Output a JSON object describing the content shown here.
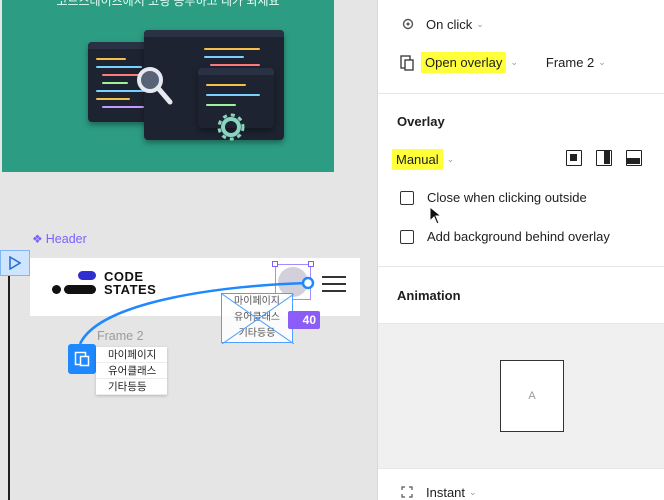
{
  "canvas": {
    "hero_text": "코드스테이츠에서 코딩 공부하고 네가 되세요",
    "header_component": "Header",
    "logo": {
      "line1": "CODE",
      "line2": "STATES"
    },
    "menu_box_items": [
      "마이페이지",
      "유어클래스",
      "기타등등"
    ],
    "badge_value": "40",
    "frame2_label": "Frame 2",
    "frame2_items": [
      "마이페이지",
      "유어클래스",
      "기타등등"
    ]
  },
  "panel": {
    "trigger": "On click",
    "action": "Open overlay",
    "destination": "Frame 2",
    "overlay_section_title": "Overlay",
    "overlay_position": "Manual",
    "close_outside_label": "Close when clicking outside",
    "add_background_label": "Add background behind overlay",
    "animation_section_title": "Animation",
    "preview_letter": "A",
    "animation_type": "Instant"
  },
  "colors": {
    "highlight": "#ffff3a",
    "figma_blue": "#1e88ff",
    "component_purple": "#7b61ff",
    "hero_green": "#2c9c83"
  }
}
